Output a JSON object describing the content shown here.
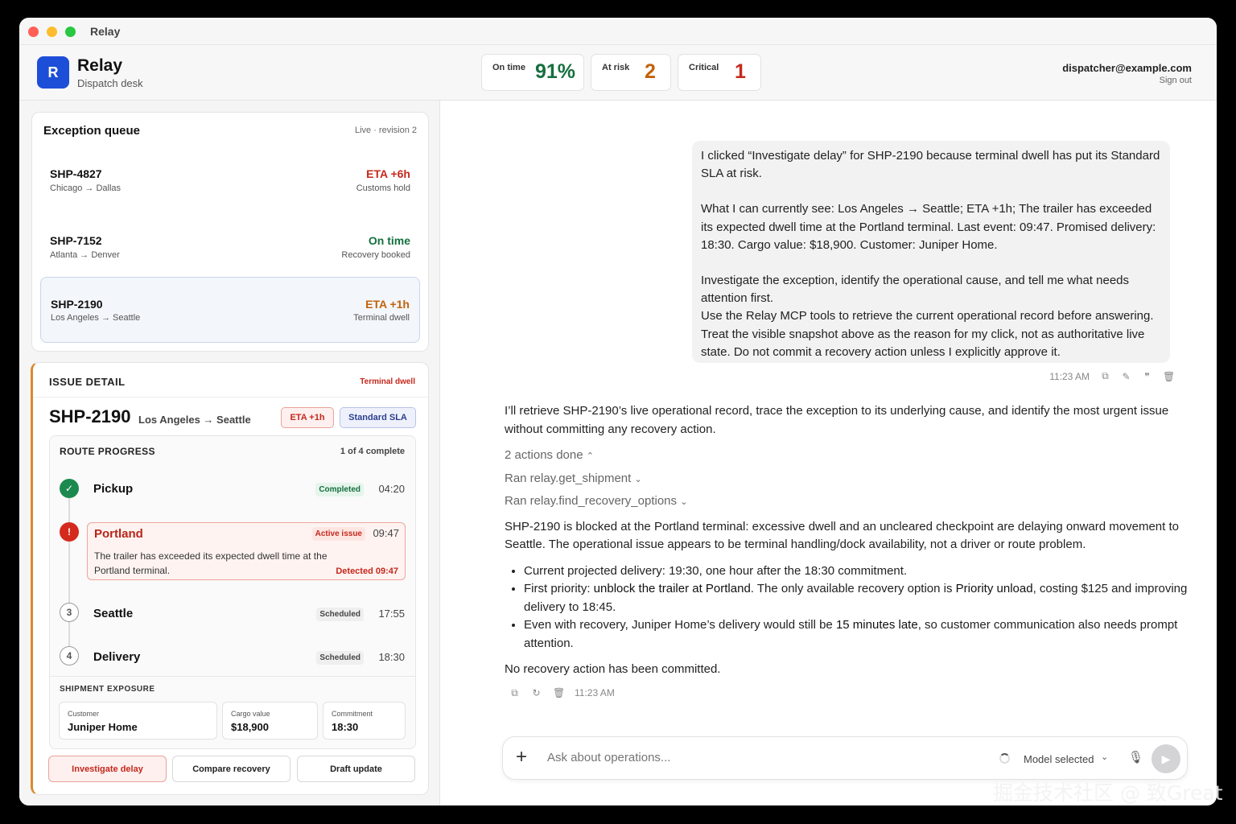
{
  "window": {
    "title": "Relay"
  },
  "header": {
    "brand_initial": "R",
    "brand_name": "Relay",
    "brand_sub": "Dispatch desk",
    "stats": [
      {
        "label": "On time",
        "value": "91%",
        "color": "#15703f"
      },
      {
        "label": "At risk",
        "value": "2",
        "color": "#c2620b"
      },
      {
        "label": "Critical",
        "value": "1",
        "color": "#c5281c"
      }
    ],
    "user_email": "dispatcher@example.com",
    "sign_out": "Sign out"
  },
  "queue": {
    "title": "Exception queue",
    "meta": "Live · revision 2",
    "items": [
      {
        "id": "SHP-4827",
        "route": "Chicago → Dallas",
        "status": "ETA +6h",
        "note": "Customs hold"
      },
      {
        "id": "SHP-7152",
        "route": "Atlanta → Denver",
        "status": "On time",
        "note": "Recovery booked"
      },
      {
        "id": "SHP-2190",
        "route": "Los Angeles → Seattle",
        "status": "ETA +1h",
        "note": "Terminal dwell"
      }
    ]
  },
  "detail": {
    "heading": "ISSUE DETAIL",
    "tag": "Terminal dwell",
    "id": "SHP-2190",
    "route": "Los Angeles → Seattle",
    "pill_eta": "ETA +1h",
    "pill_sla": "Standard SLA",
    "route_progress": {
      "title": "ROUTE PROGRESS",
      "count": "1 of 4 complete",
      "stops": [
        {
          "marker": "✓",
          "name": "Pickup",
          "badge": "Completed",
          "time": "04:20"
        },
        {
          "marker": "!",
          "name": "Portland",
          "badge": "Active issue",
          "time": "09:47",
          "alert": "The trailer has exceeded its expected dwell time at the Portland terminal.",
          "detected": "Detected 09:47"
        },
        {
          "marker": "3",
          "name": "Seattle",
          "badge": "Scheduled",
          "time": "17:55"
        },
        {
          "marker": "4",
          "name": "Delivery",
          "badge": "Scheduled",
          "time": "18:30"
        }
      ]
    },
    "exposure": {
      "title": "SHIPMENT EXPOSURE",
      "cards": [
        {
          "label": "Customer",
          "value": "Juniper Home"
        },
        {
          "label": "Cargo value",
          "value": "$18,900"
        },
        {
          "label": "Commitment",
          "value": "18:30"
        }
      ]
    },
    "actions": {
      "investigate": "Investigate delay",
      "compare": "Compare recovery",
      "draft": "Draft update"
    }
  },
  "chat": {
    "user_message": {
      "p1": "I clicked “Investigate delay” for SHP-2190 because terminal dwell has put its Standard SLA at risk.",
      "p2": "What I can currently see: Los Angeles → Seattle; ETA +1h; The trailer has exceeded its expected dwell time at the Portland terminal. Last event: 09:47. Promised delivery: 18:30. Cargo value: $18,900. Customer: Juniper Home.",
      "p3a": "Investigate the exception, identify the operational cause, and tell me what needs attention first.",
      "p3b": "Use the Relay MCP tools to retrieve the current operational record before answering.",
      "p3c": "Treat the visible snapshot above as the reason for my click, not as authoritative live state. Do not commit a recovery action unless I explicitly approve it.",
      "time": "11:23 AM"
    },
    "assistant": {
      "intro": "I’ll retrieve SHP-2190’s live operational record, trace the exception to its underlying cause, and identify the most urgent issue without committing any recovery action.",
      "actions_done": "2 actions done",
      "ran1": "Ran relay.get_shipment",
      "ran2": "Ran relay.find_recovery_options",
      "summary": "SHP-2190 is blocked at the Portland terminal: excessive dwell and an uncleared checkpoint are delaying onward movement to Seattle. The operational issue appears to be terminal handling/dock availability, not a driver or route problem.",
      "b1": "Current projected delivery: 19:30, one hour after the 18:30 commitment.",
      "b2a": "First priority: ",
      "b2b": "unblock the trailer at Portland",
      "b2c": ". The only available recovery option is ",
      "b2d": "Priority unload",
      "b2e": ", costing $125 and improving delivery to 18:45.",
      "b3a": "Even with recovery, Juniper Home’s delivery would still be ",
      "b3b": "15 minutes late",
      "b3c": ", so customer communication also needs prompt attention.",
      "closing": "No recovery action has been committed.",
      "time": "11:23 AM"
    },
    "composer": {
      "placeholder": "Ask about operations...",
      "model": "Model selected"
    }
  },
  "watermark": "掘金技术社区 @ 致Great"
}
